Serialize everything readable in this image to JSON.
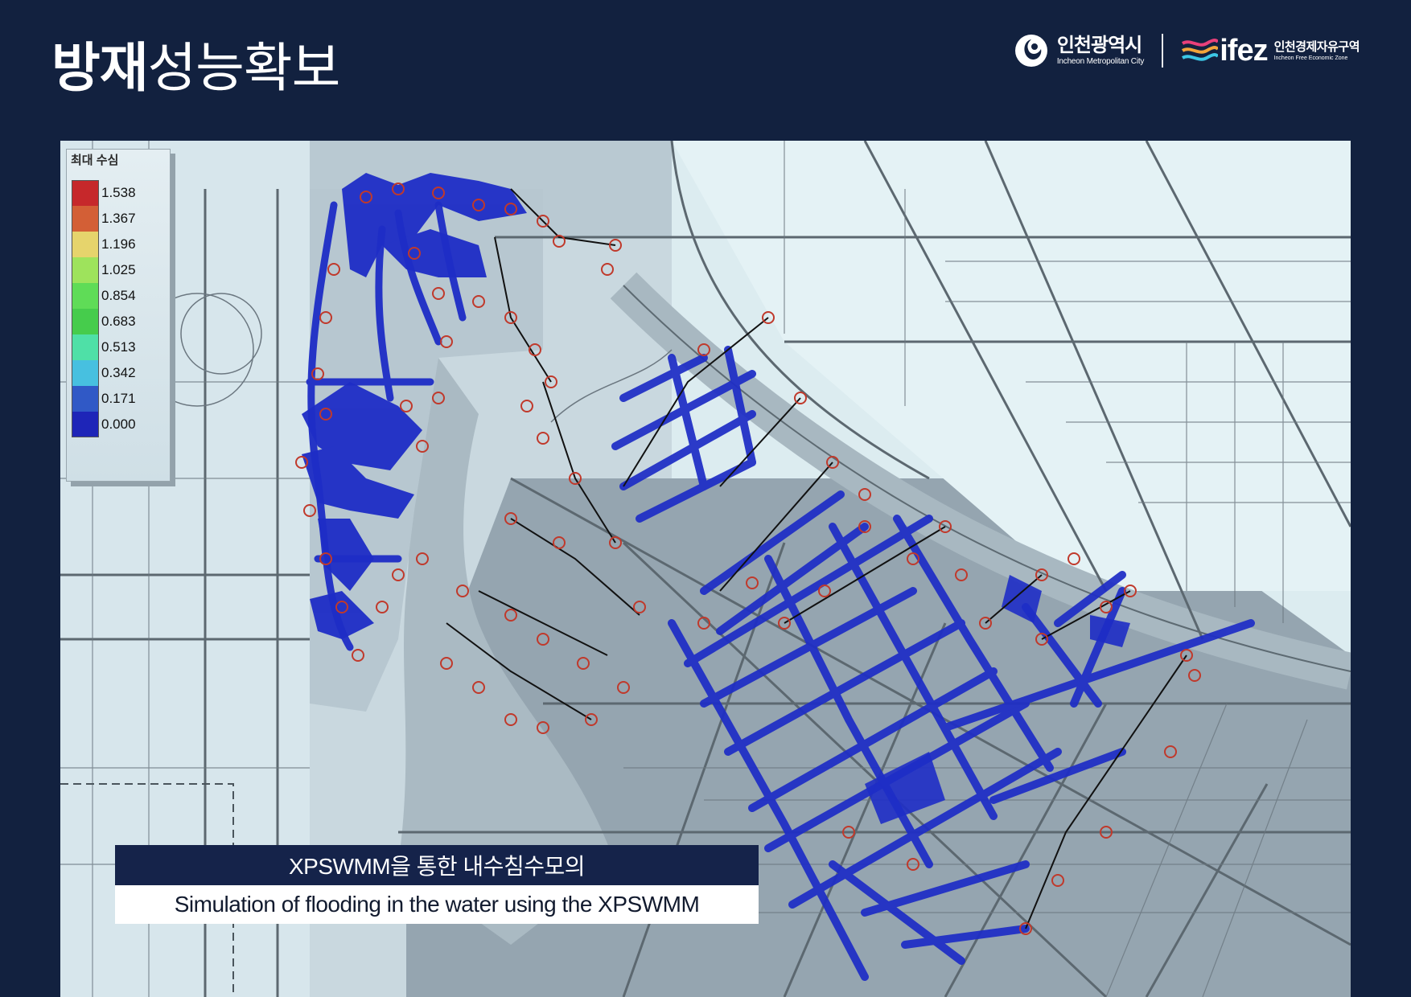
{
  "header": {
    "title_bold": "방재",
    "title_light": "성능확보"
  },
  "logos": {
    "incheon_ko": "인천광역시",
    "incheon_en": "Incheon Metropolitan City",
    "ifez_word": "ifez",
    "ifez_ko": "인천경제자유구역",
    "ifez_en": "Incheon Free Economic Zone",
    "incheon_icon": "incheon-emblem-icon",
    "ifez_icon": "ifez-wave-icon"
  },
  "map": {
    "type": "flood-depth-map",
    "legend": {
      "title": "최대 수심",
      "items": [
        {
          "value": "1.538",
          "color": "#c6282b"
        },
        {
          "value": "1.367",
          "color": "#d35f36"
        },
        {
          "value": "1.196",
          "color": "#e6d46c"
        },
        {
          "value": "1.025",
          "color": "#9ee35c"
        },
        {
          "value": "0.854",
          "color": "#5fdc57"
        },
        {
          "value": "0.683",
          "color": "#46cc4c"
        },
        {
          "value": "0.513",
          "color": "#4fe0a7"
        },
        {
          "value": "0.342",
          "color": "#47c0e0"
        },
        {
          "value": "0.171",
          "color": "#3059c6"
        },
        {
          "value": "0.000",
          "color": "#1e25b8"
        }
      ]
    },
    "flood_color": "#1e2dc6",
    "node_color": "#c0392b"
  },
  "caption": {
    "korean": "XPSWMM을 통한 내수침수모의",
    "english": "Simulation of flooding in the water using the XPSWMM"
  }
}
